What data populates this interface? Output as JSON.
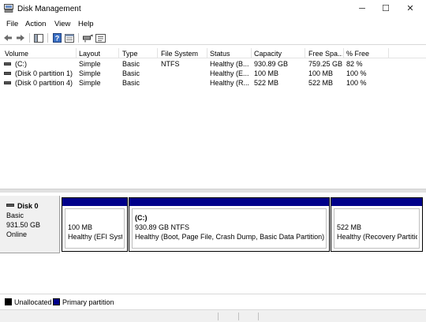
{
  "window": {
    "title": "Disk Management",
    "controls": {
      "minimize": "─",
      "maximize": "☐",
      "close": "✕"
    }
  },
  "menu": [
    "File",
    "Action",
    "View",
    "Help"
  ],
  "toolbar": {
    "icons": [
      "back-icon",
      "forward-icon",
      "console-tree-icon",
      "help-icon",
      "properties-icon",
      "rescan-icon",
      "settings-icon"
    ]
  },
  "volume_table": {
    "columns": [
      "Volume",
      "Layout",
      "Type",
      "File System",
      "Status",
      "Capacity",
      "Free Spa...",
      "% Free"
    ],
    "rows": [
      [
        "(C:)",
        "Simple",
        "Basic",
        "NTFS",
        "Healthy (B...",
        "930.89 GB",
        "759.25 GB",
        "82 %"
      ],
      [
        "(Disk 0 partition 1)",
        "Simple",
        "Basic",
        "",
        "Healthy (E...",
        "100 MB",
        "100 MB",
        "100 %"
      ],
      [
        "(Disk 0 partition 4)",
        "Simple",
        "Basic",
        "",
        "Healthy (R...",
        "522 MB",
        "522 MB",
        "100 %"
      ]
    ]
  },
  "disk": {
    "name": "Disk 0",
    "type": "Basic",
    "size": "931.50 GB",
    "state": "Online",
    "partitions": [
      {
        "label": "",
        "size": "100 MB",
        "status": "Healthy (EFI System"
      },
      {
        "label": "(C:)",
        "size": "930.89 GB NTFS",
        "status": "Healthy (Boot, Page File, Crash Dump, Basic Data Partition)"
      },
      {
        "label": "",
        "size": "522 MB",
        "status": "Healthy (Recovery Partition)"
      }
    ]
  },
  "legend": [
    {
      "label": "Unallocated",
      "color": "#000000"
    },
    {
      "label": "Primary partition",
      "color": "#00008a"
    }
  ],
  "colors": {
    "primary_partition": "#00008a",
    "unallocated": "#000000"
  }
}
